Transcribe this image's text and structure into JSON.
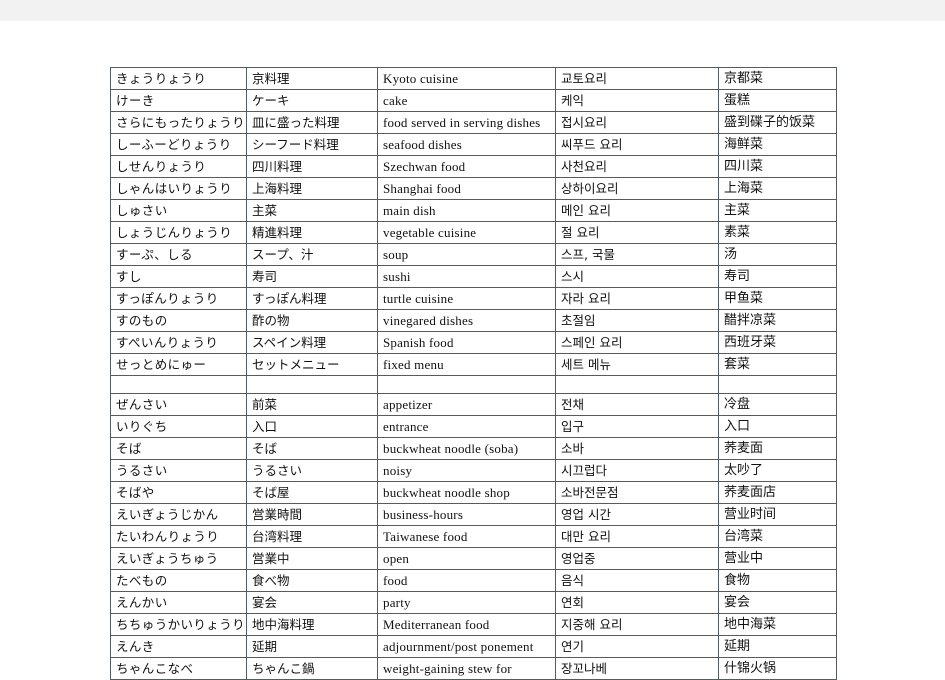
{
  "page": {
    "background_color": "#ffffff",
    "top_band_color": "#f2f2f2",
    "border_color": "#555c5f"
  },
  "table": {
    "name": "japanese-korean-chinese-food-vocabulary-table",
    "columns": [
      "kana",
      "japanese",
      "english",
      "korean",
      "chinese"
    ],
    "rows": [
      {
        "kana": "きょうりょうり",
        "japanese": "京料理",
        "english": "Kyoto cuisine",
        "korean": "교토요리",
        "chinese": "京都菜"
      },
      {
        "kana": "けーき",
        "japanese": "ケーキ",
        "english": "cake",
        "korean": "케익",
        "chinese": "蛋糕"
      },
      {
        "kana": "さらにもったりょうり",
        "japanese": "皿に盛った料理",
        "english": "food served in serving dishes",
        "korean": "접시요리",
        "chinese": "盛到碟子的饭菜"
      },
      {
        "kana": "しーふーどりょうり",
        "japanese": "シーフード料理",
        "english": "seafood dishes",
        "korean": "씨푸드 요리",
        "chinese": "海鲜菜"
      },
      {
        "kana": "しせんりょうり",
        "japanese": "四川料理",
        "english": "Szechwan food",
        "korean": "사천요리",
        "chinese": "四川菜"
      },
      {
        "kana": "しゃんはいりょうり",
        "japanese": "上海料理",
        "english": "Shanghai food",
        "korean": "상하이요리",
        "chinese": "上海菜"
      },
      {
        "kana": "しゅさい",
        "japanese": "主菜",
        "english": "main dish",
        "korean": "메인 요리",
        "chinese": "主菜"
      },
      {
        "kana": "しょうじんりょうり",
        "japanese": "精進料理",
        "english": "vegetable cuisine",
        "korean": "절 요리",
        "chinese": "素菜"
      },
      {
        "kana": "すーぷ、しる",
        "japanese": "スープ、汁",
        "english": "soup",
        "korean": "스프, 국물",
        "chinese": "汤"
      },
      {
        "kana": "すし",
        "japanese": "寿司",
        "english": "sushi",
        "korean": "스시",
        "chinese": "寿司"
      },
      {
        "kana": "すっぽんりょうり",
        "japanese": "すっぽん料理",
        "english": "turtle cuisine",
        "korean": "자라 요리",
        "chinese": "甲鱼菜"
      },
      {
        "kana": "すのもの",
        "japanese": "酢の物",
        "english": "vinegared dishes",
        "korean": "초절임",
        "chinese": "醋拌凉菜"
      },
      {
        "kana": "すぺいんりょうり",
        "japanese": "スペイン料理",
        "english": "Spanish food",
        "korean": "스페인 요리",
        "chinese": "西班牙菜"
      },
      {
        "kana": "せっとめにゅー",
        "japanese": "セットメニュー",
        "english": "fixed menu",
        "korean": "세트 메뉴",
        "chinese": "套菜"
      },
      {
        "kana": "",
        "japanese": "",
        "english": "",
        "korean": "",
        "chinese": "",
        "spacer": true
      },
      {
        "kana": "ぜんさい",
        "japanese": "前菜",
        "english": "appetizer",
        "korean": "전채",
        "chinese": "冷盘"
      },
      {
        "kana": "いりぐち",
        "japanese": "入口",
        "english": "entrance",
        "korean": "입구",
        "chinese": "入口"
      },
      {
        "kana": "そば",
        "japanese": "そば",
        "english": "buckwheat noodle (soba)",
        "korean": "소바",
        "chinese": "荞麦面"
      },
      {
        "kana": "うるさい",
        "japanese": "うるさい",
        "english": "noisy",
        "korean": "시끄럽다",
        "chinese": "太吵了"
      },
      {
        "kana": "そばや",
        "japanese": "そば屋",
        "english": "buckwheat noodle shop",
        "korean": "소바전문점",
        "chinese": "荞麦面店"
      },
      {
        "kana": "えいぎょうじかん",
        "japanese": "営業時間",
        "english": "business-hours",
        "korean": "영업 시간",
        "chinese": "营业时间"
      },
      {
        "kana": "たいわんりょうり",
        "japanese": "台湾料理",
        "english": "Taiwanese food",
        "korean": "대만 요리",
        "chinese": "台湾菜"
      },
      {
        "kana": "えいぎょうちゅう",
        "japanese": "営業中",
        "english": "open",
        "korean": "영업중",
        "chinese": "营业中"
      },
      {
        "kana": "たべもの",
        "japanese": "食べ物",
        "english": "food",
        "korean": "음식",
        "chinese": "食物"
      },
      {
        "kana": "えんかい",
        "japanese": "宴会",
        "english": "party",
        "korean": "연회",
        "chinese": "宴会"
      },
      {
        "kana": "ちちゅうかいりょうり",
        "japanese": "地中海料理",
        "english": "Mediterranean food",
        "korean": "지중해 요리",
        "chinese": "地中海菜"
      },
      {
        "kana": "えんき",
        "japanese": "延期",
        "english": "adjournment/post ponement",
        "korean": "연기",
        "chinese": "延期"
      },
      {
        "kana": "ちゃんこなべ",
        "japanese": "ちゃんこ鍋",
        "english": "weight-gaining stew for",
        "korean": "장꼬나베",
        "chinese": "什锦火锅"
      }
    ]
  }
}
